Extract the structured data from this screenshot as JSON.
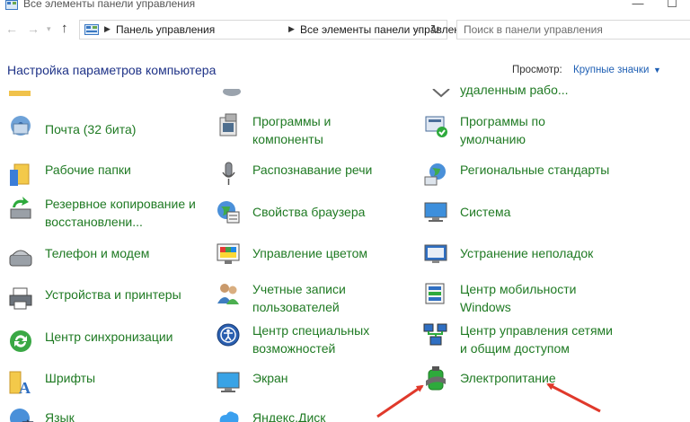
{
  "window": {
    "title": "Все элементы панели управления",
    "minimize_glyph": "—",
    "maximize_glyph": "☐"
  },
  "nav": {
    "back_icon": "back-arrow-icon",
    "forward_icon": "forward-arrow-icon",
    "up_icon": "up-arrow-icon",
    "breadcrumb": [
      "Панель управления",
      "Все элементы панели управления"
    ],
    "search_placeholder": "Поиск в панели управления"
  },
  "header": {
    "title": "Настройка параметров компьютера",
    "view_label": "Просмотр:",
    "view_value": "Крупные значки"
  },
  "partial_top": {
    "right": "удаленным рабо..."
  },
  "items": [
    {
      "lines": [
        "Почта (32 бита)"
      ],
      "icon": "mail-icon"
    },
    {
      "lines": [
        "Программы и",
        "компоненты"
      ],
      "icon": "programs-icon"
    },
    {
      "lines": [
        "Программы по",
        "умолчанию"
      ],
      "icon": "default-programs-icon"
    },
    {
      "lines": [
        "Рабочие папки"
      ],
      "icon": "work-folders-icon"
    },
    {
      "lines": [
        "Распознавание речи"
      ],
      "icon": "microphone-icon"
    },
    {
      "lines": [
        "Региональные стандарты"
      ],
      "icon": "region-globe-icon"
    },
    {
      "lines": [
        "Резервное копирование и",
        "восстановлени..."
      ],
      "icon": "backup-icon"
    },
    {
      "lines": [
        "Свойства браузера"
      ],
      "icon": "internet-options-icon"
    },
    {
      "lines": [
        "Система"
      ],
      "icon": "system-monitor-icon"
    },
    {
      "lines": [
        "Телефон и модем"
      ],
      "icon": "phone-modem-icon"
    },
    {
      "lines": [
        "Управление цветом"
      ],
      "icon": "color-management-icon"
    },
    {
      "lines": [
        "Устранение неполадок"
      ],
      "icon": "troubleshooting-icon"
    },
    {
      "lines": [
        "Устройства и принтеры"
      ],
      "icon": "printer-icon"
    },
    {
      "lines": [
        "Учетные записи",
        "пользователей"
      ],
      "icon": "user-accounts-icon"
    },
    {
      "lines": [
        "Центр мобильности",
        "Windows"
      ],
      "icon": "mobility-center-icon"
    },
    {
      "lines": [
        "Центр синхронизации"
      ],
      "icon": "sync-center-icon"
    },
    {
      "lines": [
        "Центр специальных",
        "возможностей"
      ],
      "icon": "ease-of-access-icon"
    },
    {
      "lines": [
        "Центр управления сетями",
        "и общим доступом"
      ],
      "icon": "network-center-icon"
    },
    {
      "lines": [
        "Шрифты"
      ],
      "icon": "fonts-icon"
    },
    {
      "lines": [
        "Экран"
      ],
      "icon": "display-icon"
    },
    {
      "lines": [
        "Электропитание"
      ],
      "icon": "power-options-icon"
    },
    {
      "lines": [
        "Язык"
      ],
      "icon": "language-icon"
    },
    {
      "lines": [
        "Яндекс.Диск"
      ],
      "icon": "yandex-disk-icon"
    }
  ],
  "colors": {
    "link_green": "#1f7a23",
    "header_blue": "#1e3287",
    "annotation_red": "#e0392b"
  }
}
